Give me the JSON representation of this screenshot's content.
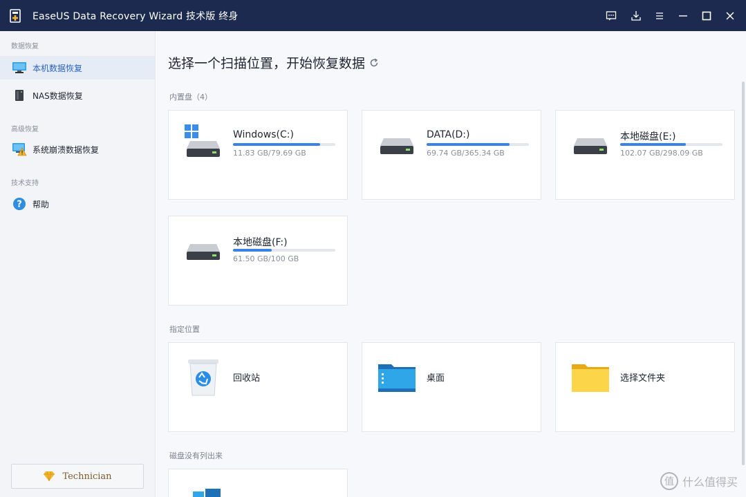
{
  "titlebar": {
    "title": "EaseUS Data Recovery Wizard 技术版 终身",
    "controls": [
      "feedback-icon",
      "download-icon",
      "menu-icon",
      "minimize-icon",
      "maximize-icon",
      "close-icon"
    ]
  },
  "sidebar": {
    "groups": [
      {
        "label": "数据恢复"
      },
      {
        "label": "高级恢复"
      },
      {
        "label": "技术支持"
      }
    ],
    "items": [
      {
        "label": "本机数据恢复",
        "icon": "monitor-icon",
        "active": true
      },
      {
        "label": "NAS数据恢复",
        "icon": "nas-icon",
        "active": false
      },
      {
        "label": "系统崩溃数据恢复",
        "icon": "system-crash-icon",
        "active": false
      },
      {
        "label": "帮助",
        "icon": "help-icon",
        "active": false
      }
    ],
    "technician_label": "Technician"
  },
  "main": {
    "title": "选择一个扫描位置，开始恢复数据",
    "sections": {
      "internal": "内置盘（4）",
      "locations": "指定位置",
      "unlisted": "磁盘没有列出来"
    },
    "drives": [
      {
        "name": "Windows(C:)",
        "capacity": "11.83 GB/79.69 GB",
        "usage": 0.85,
        "os": true
      },
      {
        "name": "DATA(D:)",
        "capacity": "69.74 GB/365.34 GB",
        "usage": 0.81,
        "os": false
      },
      {
        "name": "本地磁盘(E:)",
        "capacity": "102.07 GB/298.09 GB",
        "usage": 0.64,
        "os": false
      },
      {
        "name": "本地磁盘(F:)",
        "capacity": "61.50 GB/100 GB",
        "usage": 0.38,
        "os": false
      }
    ],
    "locations": [
      {
        "name": "回收站",
        "icon": "recycle-bin-icon"
      },
      {
        "name": "桌面",
        "icon": "desktop-folder-icon"
      },
      {
        "name": "选择文件夹",
        "icon": "folder-icon"
      }
    ]
  },
  "colors": {
    "titlebar": "#1b2a4e",
    "accent": "#3b82e6",
    "active_bg": "#e6ecf6"
  },
  "watermark": {
    "text": "什么值得买",
    "glyph": "值"
  }
}
